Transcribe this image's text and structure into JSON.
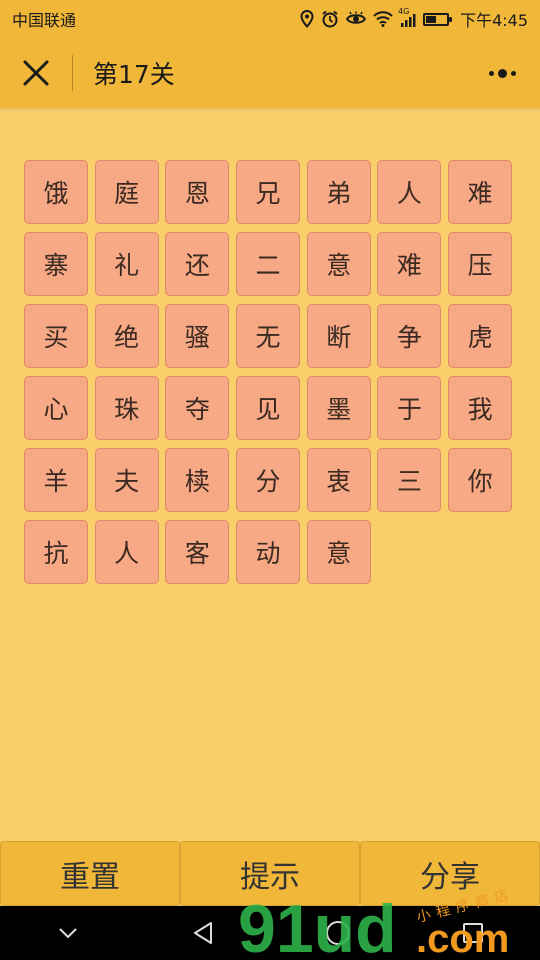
{
  "status": {
    "carrier": "中国联通",
    "network": "4G",
    "time": "下午4:45"
  },
  "header": {
    "title": "第17关"
  },
  "board": {
    "tiles": [
      "饿",
      "庭",
      "恩",
      "兄",
      "弟",
      "人",
      "难",
      "寨",
      "礼",
      "还",
      "二",
      "意",
      "难",
      "压",
      "买",
      "绝",
      "骚",
      "无",
      "断",
      "争",
      "虎",
      "心",
      "珠",
      "夺",
      "见",
      "墨",
      "于",
      "我",
      "羊",
      "夫",
      "椟",
      "分",
      "衷",
      "三",
      "你",
      "抗",
      "人",
      "客",
      "动",
      "意"
    ]
  },
  "actions": {
    "reset_label": "重置",
    "hint_label": "提示",
    "share_label": "分享"
  },
  "watermark": {
    "logo_text": "91ud",
    "domain_text": ".com",
    "tagline": "小程序商店"
  },
  "colors": {
    "header_bg": "#f0b739",
    "page_bg": "#f9cf6b",
    "tile_bg": "#f7a884",
    "tile_border": "#e0886a",
    "watermark_green": "#2eb34b",
    "watermark_orange": "#f29a1f"
  }
}
